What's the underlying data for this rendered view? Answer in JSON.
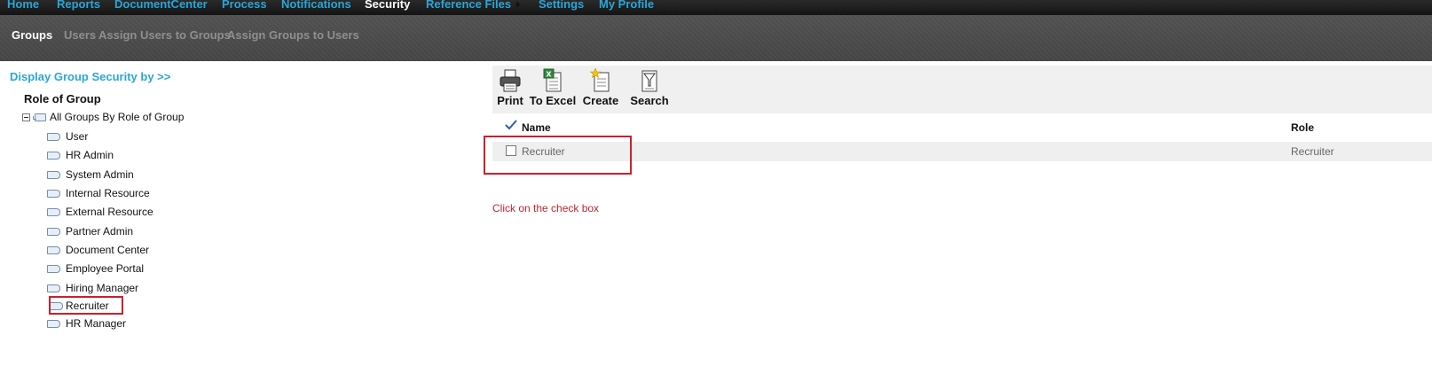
{
  "top_nav": {
    "items": [
      "Home",
      "Reports",
      "DocumentCenter",
      "Process",
      "Notifications",
      "Security",
      "Reference Files",
      "Settings",
      "My Profile"
    ],
    "active": "Security"
  },
  "sub_nav": {
    "items": [
      "Groups",
      "Users",
      "Assign Users to Groups",
      "Assign Groups to Users"
    ],
    "active": "Groups"
  },
  "left_panel": {
    "display_by_link": "Display Group Security by >>",
    "tree_heading": "Role of Group",
    "root_label": "All Groups By Role of Group",
    "nodes": [
      "User",
      "HR Admin",
      "System Admin",
      "Internal Resource",
      "External Resource",
      "Partner Admin",
      "Document Center",
      "Employee Portal",
      "Hiring Manager",
      "Recruiter",
      "HR Manager"
    ],
    "highlighted_node": "Recruiter"
  },
  "toolbar": {
    "print": "Print",
    "to_excel": "To Excel",
    "create": "Create",
    "search": "Search"
  },
  "grid": {
    "columns": {
      "name": "Name",
      "role": "Role"
    },
    "rows": [
      {
        "name": "Recruiter",
        "role": "Recruiter",
        "checked": false
      }
    ]
  },
  "annotation": {
    "text": "Click on the check box",
    "color": "#c0252e"
  },
  "colors": {
    "accent": "#2aa6d8",
    "highlight": "#cc1f2e",
    "nav_bg": "#1e1e1e",
    "subnav_bg": "#4a4a4a"
  }
}
